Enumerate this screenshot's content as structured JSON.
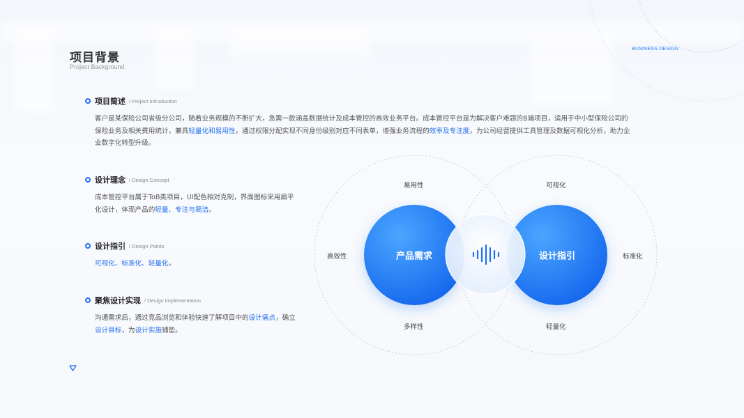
{
  "header": {
    "title": "项目背景",
    "subtitle": "Project Background",
    "brand_tag": "BUSINESS DESIGN"
  },
  "sections": [
    {
      "title": "项目简述",
      "subtitle": "/ Project Introduction",
      "lines": [
        [
          {
            "t": "客户是某保险公司省级分公司，随着业务规模的不断扩大，急需一款涵盖数据统计及成本管控的高效业务平台。成本管控平台是为解决客户难题的B端项目，适用于中小型保险公司的"
          }
        ],
        [
          {
            "t": "保险业务及相关费用统计，兼具"
          },
          {
            "t": "轻量化和易用性",
            "hl": true
          },
          {
            "t": "，通过权限分配实现不同身份级别对应不同表单，增强业务流程的"
          },
          {
            "t": "效率及专注度",
            "hl": true
          },
          {
            "t": "，为公司经营提供工具管理及数据可视化分析，助力企"
          }
        ],
        [
          {
            "t": "业数字化转型升级。"
          }
        ]
      ]
    },
    {
      "title": "设计理念",
      "subtitle": "/ Design Concept",
      "lines": [
        [
          {
            "t": "成本管控平台属于ToB类项目，UI配色相对克制，界面图标采用扁平"
          }
        ],
        [
          {
            "t": "化设计，体现产品的"
          },
          {
            "t": "轻量、专注与简洁",
            "hl": true
          },
          {
            "t": "。"
          }
        ]
      ]
    },
    {
      "title": "设计指引",
      "subtitle": "/ Design Points",
      "lines": [
        [
          {
            "t": "可视化、标准化、轻量化",
            "hl": true
          },
          {
            "t": "。"
          }
        ]
      ]
    },
    {
      "title": "聚焦设计实现",
      "subtitle": "/ Design Implementation",
      "lines": [
        [
          {
            "t": "沟通需求后，通过竞品浏览和体验快速了解项目中的"
          },
          {
            "t": "设计痛点",
            "hl": true
          },
          {
            "t": "，确立"
          }
        ],
        [
          {
            "t": "设计目标",
            "hl": true
          },
          {
            "t": "，为"
          },
          {
            "t": "设计实施",
            "hl": true
          },
          {
            "t": "铺垫。"
          }
        ]
      ]
    }
  ],
  "venn": {
    "left_circle": "产品需求",
    "right_circle": "设计指引",
    "labels": {
      "top_left": "易用性",
      "top_right": "可视化",
      "left": "高效性",
      "right": "标准化",
      "bottom_left": "多样性",
      "bottom_right": "轻量化"
    },
    "center_icon": "sound-wave-icon",
    "colors": {
      "primary": "#1e6ef0",
      "primary_light": "#4aa0ff"
    }
  },
  "icons": {
    "nav": "triangle-down-icon"
  }
}
